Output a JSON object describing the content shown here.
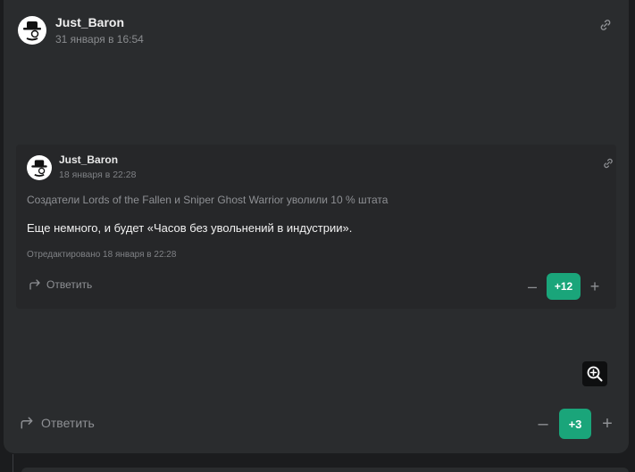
{
  "comment": {
    "author": "Just_Baron",
    "date": "31 января в 16:54",
    "reply_label": "Ответить",
    "score": "+3",
    "minus": "–",
    "plus": "+",
    "quote": {
      "author": "Just_Baron",
      "date": "18 января в 22:28",
      "source": "Создатели Lords of the Fallen и Sniper Ghost Warrior уволили 10 % штата",
      "text": "Еще немного, и будет «Часов без увольнений в индустрии».",
      "edited": "Отредактировано 18 января в 22:28",
      "reply_label": "Ответить",
      "score": "+12",
      "minus": "–",
      "plus": "+"
    }
  },
  "colors": {
    "score_bg": "#1aa57a",
    "card_bg": "#2a2c2e",
    "page_bg": "#1b1c1e"
  },
  "icons": {
    "avatar": "avatar-hat-monocle-icon",
    "link": "link-icon",
    "reply": "reply-arrow-icon",
    "zoom": "zoom-in-icon"
  }
}
